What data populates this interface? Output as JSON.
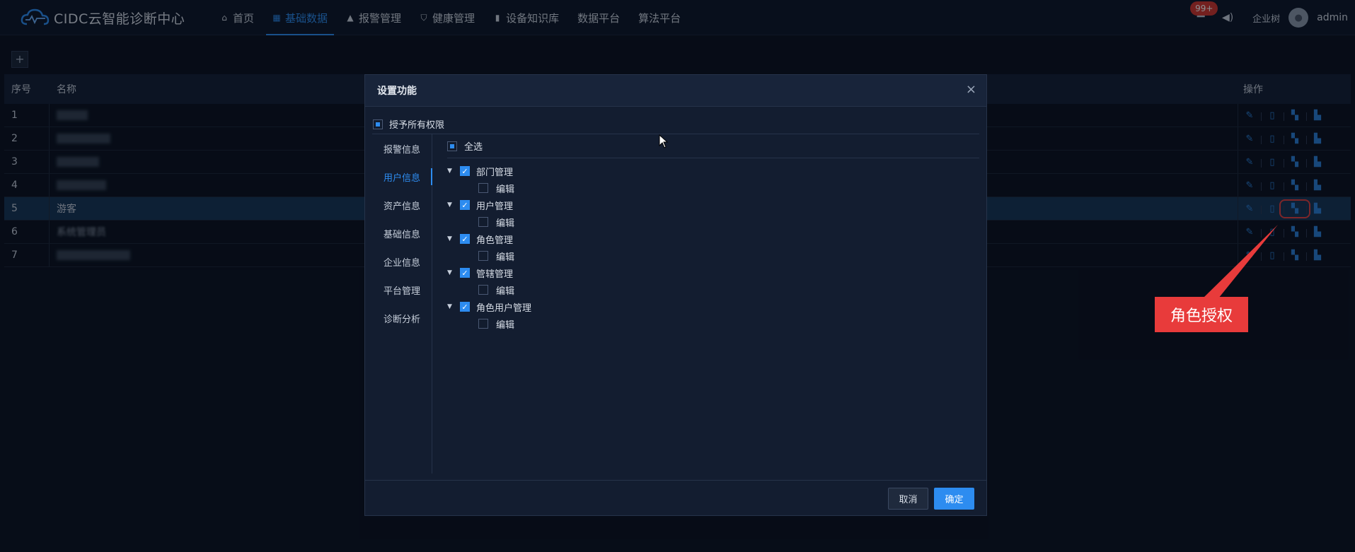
{
  "app": {
    "title": "CIDC云智能诊断中心"
  },
  "nav": {
    "items": [
      {
        "label": "首页",
        "icon": "home-icon"
      },
      {
        "label": "基础数据",
        "icon": "grid-icon",
        "active": true
      },
      {
        "label": "报警管理",
        "icon": "alarm-icon"
      },
      {
        "label": "健康管理",
        "icon": "shield-icon"
      },
      {
        "label": "设备知识库",
        "icon": "book-icon"
      },
      {
        "label": "数据平台"
      },
      {
        "label": "算法平台"
      }
    ]
  },
  "header_right": {
    "badge": "99+",
    "company": "企业树",
    "username": "admin"
  },
  "toolbar": {
    "add_label": "+"
  },
  "table": {
    "headers": {
      "no": "序号",
      "name": "名称",
      "op": "操作"
    },
    "rows": [
      {
        "no": "1",
        "name": "",
        "blurred": true
      },
      {
        "no": "2",
        "name": "",
        "blurred": true
      },
      {
        "no": "3",
        "name": "",
        "blurred": true
      },
      {
        "no": "4",
        "name": "",
        "blurred": true
      },
      {
        "no": "5",
        "name": "游客",
        "selected": true
      },
      {
        "no": "6",
        "name": "系统管理员",
        "blurred": true
      },
      {
        "no": "7",
        "name": "",
        "blurred": true
      }
    ],
    "op_icons": [
      "edit-icon",
      "delete-icon",
      "role-auth-icon",
      "assign-icon"
    ]
  },
  "dialog": {
    "title": "设置功能",
    "close": "×",
    "grant_all": "授予所有权限",
    "side_menu": [
      {
        "label": "报警信息"
      },
      {
        "label": "用户信息",
        "active": true
      },
      {
        "label": "资产信息"
      },
      {
        "label": "基础信息"
      },
      {
        "label": "企业信息"
      },
      {
        "label": "平台管理"
      },
      {
        "label": "诊断分析"
      }
    ],
    "select_all": "全选",
    "tree": [
      {
        "label": "部门管理",
        "checked": true,
        "child": "编辑"
      },
      {
        "label": "用户管理",
        "checked": true,
        "child": "编辑"
      },
      {
        "label": "角色管理",
        "checked": true,
        "child": "编辑"
      },
      {
        "label": "管辖管理",
        "checked": true,
        "child": "编辑"
      },
      {
        "label": "角色用户管理",
        "checked": true,
        "child": "编辑"
      }
    ],
    "cancel": "取消",
    "ok": "确定"
  },
  "annotation": {
    "text": "角色授权",
    "color": "#e83b3b"
  },
  "colors": {
    "accent": "#2d8cf0",
    "background": "#0b1220",
    "annotation": "#e83b3b"
  }
}
